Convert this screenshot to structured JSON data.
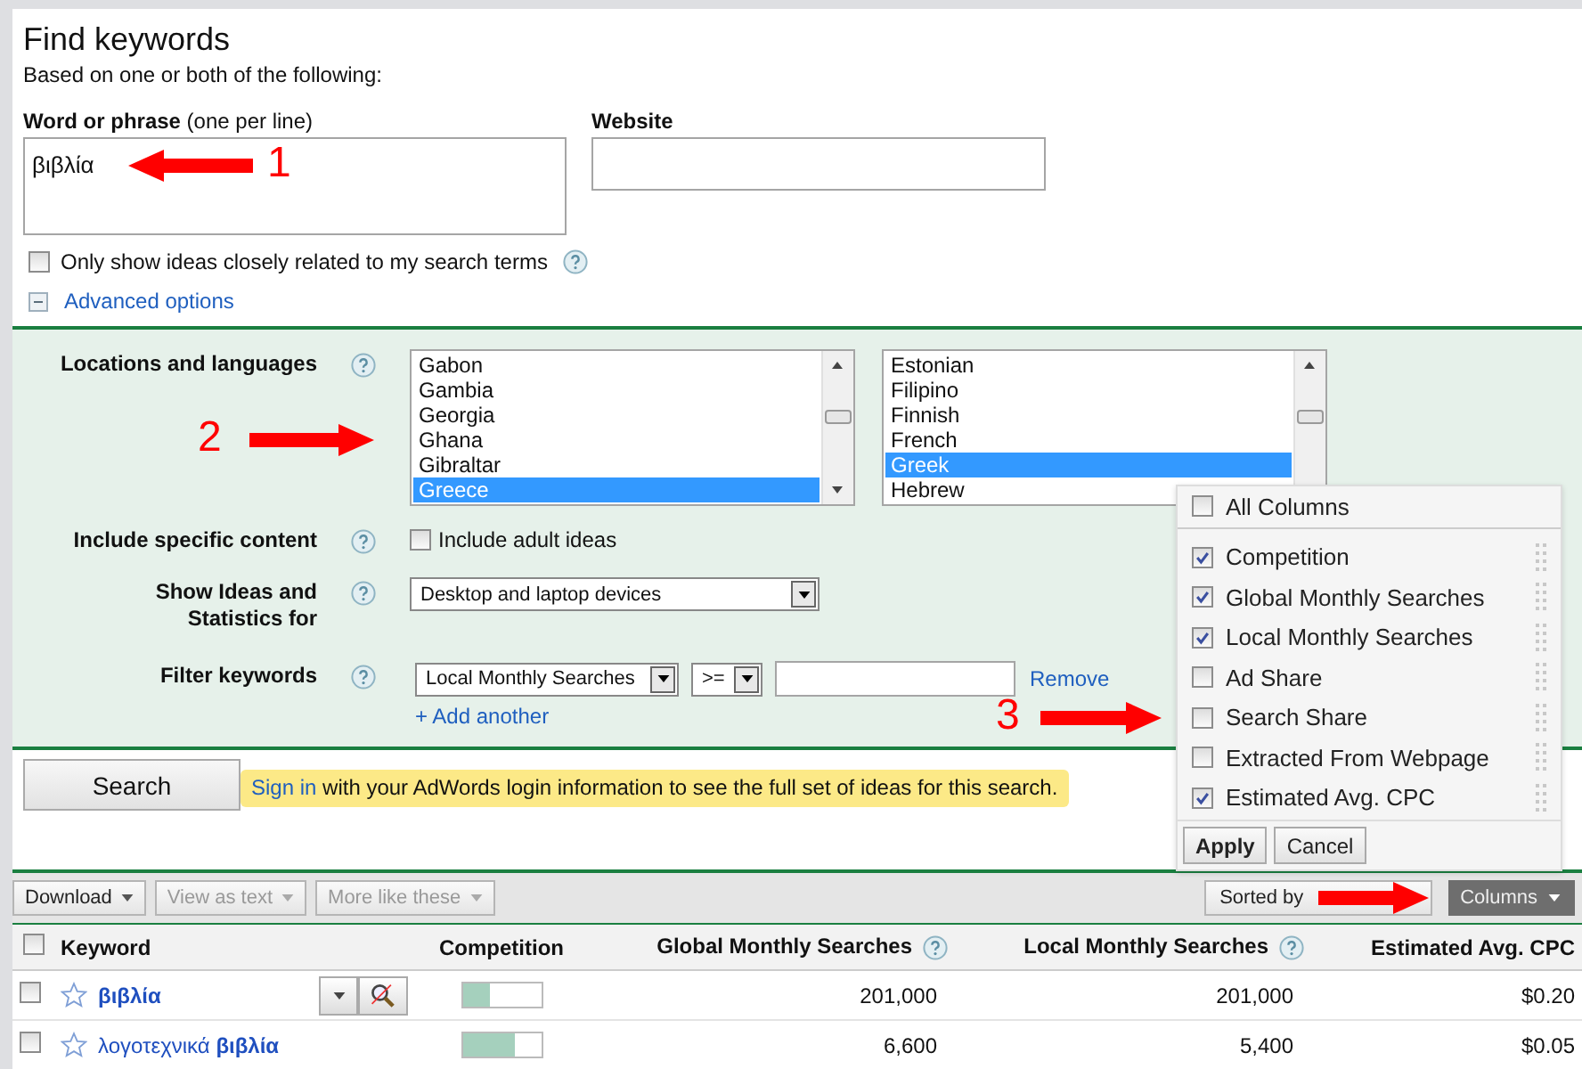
{
  "title": "Find keywords",
  "subtitle": "Based on one or both of the following:",
  "word_field": {
    "label": "Word or phrase",
    "hint": "(one per line)",
    "value": "βιβλία"
  },
  "website_field": {
    "label": "Website"
  },
  "closely_related": {
    "label": "Only show ideas closely related to my search terms",
    "checked": false
  },
  "advanced": {
    "label": "Advanced options",
    "expanded": true
  },
  "locations": {
    "label": "Locations and languages",
    "countries": [
      {
        "name": "Gabon",
        "selected": false
      },
      {
        "name": "Gambia",
        "selected": false
      },
      {
        "name": "Georgia",
        "selected": false
      },
      {
        "name": "Ghana",
        "selected": false
      },
      {
        "name": "Gibraltar",
        "selected": false
      },
      {
        "name": "Greece",
        "selected": true
      }
    ],
    "languages": [
      {
        "name": "Estonian",
        "selected": false
      },
      {
        "name": "Filipino",
        "selected": false
      },
      {
        "name": "Finnish",
        "selected": false
      },
      {
        "name": "French",
        "selected": false
      },
      {
        "name": "Greek",
        "selected": true
      },
      {
        "name": "Hebrew",
        "selected": false
      }
    ]
  },
  "specific_content": {
    "label": "Include specific content",
    "option": "Include adult ideas",
    "checked": false
  },
  "device": {
    "label": "Show Ideas and Statistics for",
    "value": "Desktop and laptop devices"
  },
  "filter": {
    "label": "Filter keywords",
    "metric": "Local Monthly Searches",
    "operator": ">=",
    "remove": "Remove",
    "add": "+ Add another"
  },
  "search_button": "Search",
  "notice": {
    "link": "Sign in",
    "text": "with your AdWords login information to see the full set of ideas for this search."
  },
  "toolbar": {
    "buttons": [
      {
        "label": "Download",
        "disabled": false
      },
      {
        "label": "View as text",
        "disabled": true
      },
      {
        "label": "More like these",
        "disabled": true
      }
    ],
    "sorted": "Sorted by",
    "columns": "Columns"
  },
  "table": {
    "all_checked": false,
    "columns": [
      "Keyword",
      "Competition",
      "Global Monthly Searches",
      "Local Monthly Searches",
      "Estimated Avg. CPC"
    ],
    "rows": [
      {
        "checked": false,
        "exact_match": true,
        "keyword": "βιβλία",
        "tools": true,
        "competition": {
          "level": 0.35
        },
        "global": "201,000",
        "local": "201,000",
        "cpc": "$0.20"
      },
      {
        "checked": false,
        "exact_match": false,
        "keyword": "λογοτεχνικά **βιβλία**",
        "tools": false,
        "competition": {
          "level": 0.68
        },
        "global": "6,600",
        "local": "5,400",
        "cpc": "$0.05"
      }
    ]
  },
  "columns_menu": {
    "all": {
      "label": "All Columns",
      "checked": false
    },
    "items": [
      {
        "label": "Competition",
        "checked": true
      },
      {
        "label": "Global Monthly Searches",
        "checked": true
      },
      {
        "label": "Local Monthly Searches",
        "checked": true
      },
      {
        "label": "Ad Share",
        "checked": false
      },
      {
        "label": "Search Share",
        "checked": false
      },
      {
        "label": "Extracted From Webpage",
        "checked": false
      },
      {
        "label": "Estimated Avg. CPC",
        "checked": true
      }
    ],
    "apply": "Apply",
    "cancel": "Cancel"
  },
  "annotations": [
    "1",
    "2",
    "3"
  ]
}
